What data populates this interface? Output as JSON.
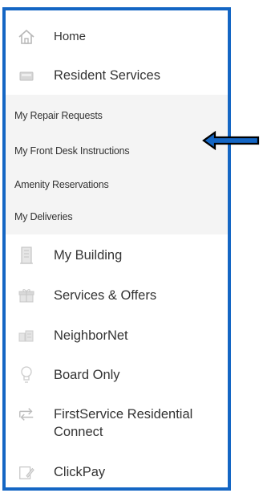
{
  "menu": {
    "home": {
      "label": "Home",
      "icon": "home-icon"
    },
    "resident_services": {
      "label": "Resident Services",
      "icon": "resident-services-icon",
      "subitems": [
        "My Repair Requests",
        "My Front Desk Instructions",
        "Amenity Reservations",
        "My Deliveries"
      ]
    },
    "my_building": {
      "label": "My Building",
      "icon": "building-icon"
    },
    "services_offers": {
      "label": "Services & Offers",
      "icon": "gift-icon"
    },
    "neighbornet": {
      "label": "NeighborNet",
      "icon": "neighbornet-icon"
    },
    "board_only": {
      "label": "Board Only",
      "icon": "lightbulb-icon"
    },
    "fsr_connect": {
      "label_line1": "FirstService Residential",
      "label_line2": "Connect",
      "icon": "transfer-icon"
    },
    "clickpay": {
      "label": "ClickPay",
      "icon": "clickpay-icon"
    }
  },
  "colors": {
    "border": "#1466c4",
    "icon": "#c4c4c4",
    "arrow_fill": "#1466c4",
    "arrow_outline": "#000000",
    "submenu_bg": "#f4f4f4"
  }
}
